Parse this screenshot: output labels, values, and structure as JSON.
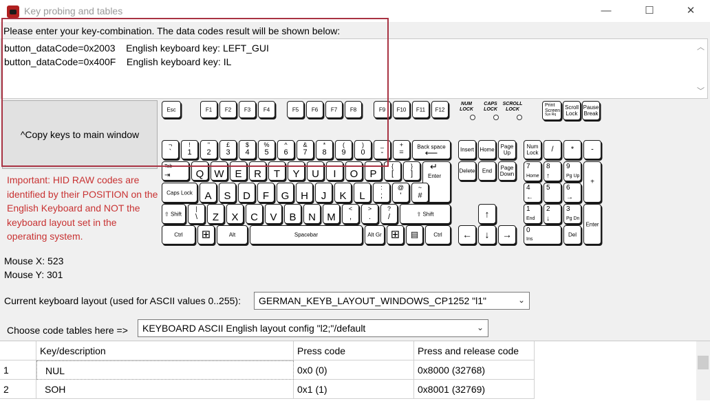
{
  "window": {
    "title": "Key probing and tables",
    "minimize": "—",
    "maximize": "☐",
    "close": "✕"
  },
  "instruction": "Please enter your key-combination. The data codes result will be shown below:",
  "output_lines": [
    "button_dataCode=0x2003    English keyboard key: LEFT_GUI",
    "button_dataCode=0x400F    English keyboard key: IL"
  ],
  "copy_button": "^Copy keys to main window",
  "important": "Important: HID RAW codes are identified by their POSITION  on the English Keyboard and NOT the keyboard layout set in the operating system.",
  "mouse": {
    "x": "Mouse X: 523",
    "y": "Mouse Y: 301"
  },
  "layout": {
    "label": "Current keyboard layout (used for ASCII values 0..255):",
    "value": "GERMAN_KEYB_LAYOUT_WINDOWS_CP1252 \"l1\""
  },
  "code_tables": {
    "label": "Choose code tables here =>",
    "value": "KEYBOARD ASCII English layout config \"l2;\"/default"
  },
  "table": {
    "headers": [
      "",
      "Key/description",
      "Press code",
      "Press and release code"
    ],
    "rows": [
      [
        "1",
        "NUL",
        "0x0 (0)",
        "0x8000 (32768)"
      ],
      [
        "2",
        "SOH",
        "0x1 (1)",
        "0x8001 (32769)"
      ]
    ]
  },
  "keyboard": {
    "indicators": [
      "NUM\nLOCK",
      "CAPS\nLOCK",
      "SCROLL\nLOCK"
    ],
    "fn_row": [
      "Esc",
      "F1",
      "F2",
      "F3",
      "F4",
      "F5",
      "F6",
      "F7",
      "F8",
      "F9",
      "F10",
      "F11",
      "F12"
    ],
    "sys_keys": [
      "Print\nScreen",
      "Scroll\nLock",
      "Pause\nBreak"
    ],
    "sysrq": "Sys Rq",
    "num_row": [
      [
        "¬",
        "`"
      ],
      [
        "!",
        "1"
      ],
      [
        "\"",
        "2"
      ],
      [
        "£",
        "3"
      ],
      [
        "$",
        "4"
      ],
      [
        "%",
        "5"
      ],
      [
        "^",
        "6"
      ],
      [
        "&",
        "7"
      ],
      [
        "*",
        "8"
      ],
      [
        "(",
        "9"
      ],
      [
        ")",
        "0"
      ],
      [
        "_",
        "-"
      ],
      [
        "+",
        "="
      ]
    ],
    "backspace": "Back space",
    "tab": "Tab",
    "q_row": [
      "Q",
      "W",
      "E",
      "R",
      "T",
      "Y",
      "U",
      "I",
      "O",
      "P"
    ],
    "brackets": [
      [
        "{",
        "["
      ],
      [
        "}",
        "]"
      ]
    ],
    "enter": "Enter",
    "caps": "Caps Lock",
    "a_row": [
      "A",
      "S",
      "D",
      "F",
      "G",
      "H",
      "J",
      "K",
      "L"
    ],
    "a_row_sym": [
      [
        ":",
        ";"
      ],
      [
        "@",
        "'"
      ],
      [
        "~",
        "#"
      ]
    ],
    "shift": "Shift",
    "z_row": [
      [
        "|",
        "\\"
      ],
      [
        "Z",
        ""
      ],
      [
        "X",
        ""
      ],
      [
        "C",
        ""
      ],
      [
        "V",
        ""
      ],
      [
        "B",
        ""
      ],
      [
        "N",
        ""
      ],
      [
        "M",
        ""
      ],
      [
        "<",
        ","
      ],
      [
        ">",
        "."
      ],
      [
        "?",
        "/"
      ]
    ],
    "ctrl": "Ctrl",
    "alt": "Alt",
    "spacebar": "Spacebar",
    "altgr": "Alt Gr",
    "nav_top": [
      "Insert",
      "Home",
      "Page\nUp"
    ],
    "nav_bottom": [
      "Delete",
      "End",
      "Page\nDown"
    ],
    "num_top": [
      "Num\nLock",
      "/",
      "*",
      "-"
    ],
    "numpad": {
      "n7": [
        "7",
        "Home"
      ],
      "n8": [
        "8",
        "↑"
      ],
      "n9": [
        "9",
        "Pg Up"
      ],
      "n4": [
        "4",
        "←"
      ],
      "n5": [
        "5",
        ""
      ],
      "n6": [
        "6",
        "→"
      ],
      "n1": [
        "1",
        "End"
      ],
      "n2": [
        "2",
        "↓"
      ],
      "n3": [
        "3",
        "Pg Dn"
      ],
      "n0": [
        "0",
        "Ins"
      ],
      "ndel": "Del",
      "plus": "+",
      "enter": "Enter"
    },
    "arrows": [
      "↑",
      "←",
      "↓",
      "→"
    ]
  }
}
